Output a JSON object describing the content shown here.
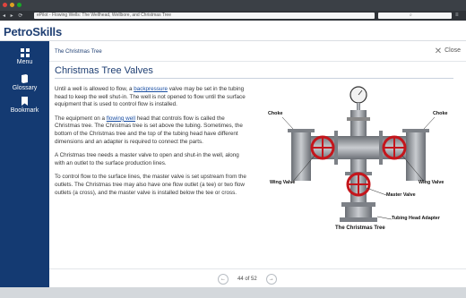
{
  "window": {
    "url_text": "ePilot - Flowing Wells: The Wellhead, Wellbore, and Christmas Tree"
  },
  "header": {
    "logo": "PetroSkills"
  },
  "sidebar": {
    "items": [
      {
        "label": "Menu",
        "icon": "grid-icon"
      },
      {
        "label": "Glossary",
        "icon": "book-icon"
      },
      {
        "label": "Bookmark",
        "icon": "bookmark-icon"
      }
    ]
  },
  "content": {
    "breadcrumb": "The Christmas Tree",
    "close_label": "Close",
    "title": "Christmas Tree Valves",
    "paragraphs": {
      "p1_a": "Until a well is allowed to flow, a ",
      "p1_link": "backpressure",
      "p1_b": " valve may be set in the tubing head to keep the well shut-in. The well is not opened to flow until the surface equipment that is used to control flow is installed.",
      "p2_a": "The equipment on a ",
      "p2_link": "flowing well",
      "p2_b": " head that controls flow is called the Christmas tree. The Christmas tree is set above the tubing. Sometimes, the bottom of the Christmas tree and the top of the tubing head have different dimensions and an adapter is required to connect the parts.",
      "p3": "A Christmas tree needs a master valve to open and shut-in the well, along with an outlet to the surface production lines.",
      "p4": "To control flow to the surface lines, the master valve is set upstream from the outlets. The Christmas tree may also have one flow outlet (a tee) or two flow outlets (a cross), and the master valve is installed below the tee or cross."
    },
    "diagram_labels": {
      "choke_left": "Choke",
      "choke_right": "Choke",
      "wing_valve_left": "Wing Valve",
      "wing_valve_right": "Wing Valve",
      "master_valve": "Master Valve",
      "tubing_head_adapter": "Tubing Head Adapter",
      "caption": "The Christmas Tree"
    }
  },
  "footer": {
    "page_text": "44 of 52"
  }
}
